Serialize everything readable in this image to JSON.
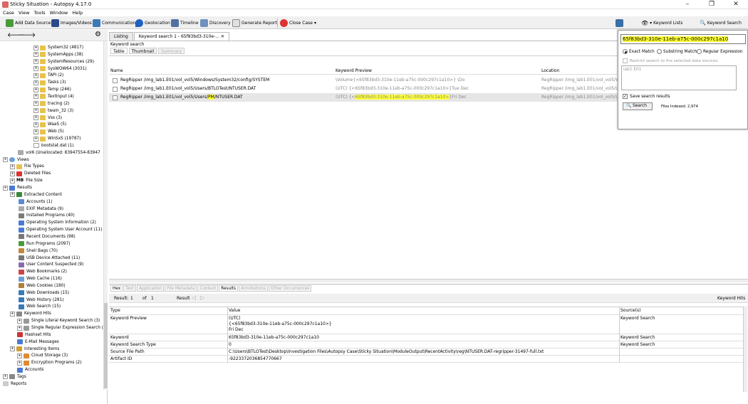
{
  "window": {
    "title": "Sticky Situation - Autopsy 4.17.0"
  },
  "menu": [
    "Case",
    "View",
    "Tools",
    "Window",
    "Help"
  ],
  "toolbar": {
    "add_data_source": "Add Data Source",
    "images_videos": "Images/Videos",
    "communications": "Communications",
    "geolocation": "Geolocation",
    "timeline": "Timeline",
    "discovery": "Discovery",
    "generate_report": "Generate Report",
    "close_case": "Close Case",
    "keyword_lists": "Keyword Lists",
    "keyword_search": "Keyword Search"
  },
  "tree": {
    "files": [
      "System32 (4817)",
      "SystemApps (38)",
      "SystemResources (29)",
      "SysWOW64 (3031)",
      "TAPI (2)",
      "Tasks (3)",
      "Temp (246)",
      "TextInput (4)",
      "tracing (2)",
      "twain_32 (3)",
      "Vss (3)",
      "WaaS (5)",
      "Web (5)",
      "WinSxS (19787)",
      "bootstat.dat (1)"
    ],
    "vol6": "vol6 (Unallocated: 83947554-83947",
    "views": "Views",
    "file_types": "File Types",
    "deleted_files": "Deleted Files",
    "mb_icon": "MB",
    "file_size": "File Size",
    "results": "Results",
    "extracted_content": "Extracted Content",
    "extracted": [
      "Accounts (1)",
      "EXIF Metadata (9)",
      "Installed Programs (40)",
      "Operating System Information (2)",
      "Operating System User Account (11)",
      "Recent Documents (98)",
      "Run Programs (2097)",
      "Shell Bags (70)",
      "USB Device Attached (11)",
      "User Content Suspected (9)",
      "Web Bookmarks (2)",
      "Web Cache (116)",
      "Web Cookies (180)",
      "Web Downloads (15)",
      "Web History (281)",
      "Web Search (15)"
    ],
    "keyword_hits": "Keyword Hits",
    "kw_children": [
      "Single Literal Keyword Search (3)",
      "Single Regular Expression Search (0)"
    ],
    "hashset_hits": "Hashset Hits",
    "email_messages": "E-Mail Messages",
    "interesting_items": "Interesting Items",
    "interesting_children": [
      "Cloud Storage (3)",
      "Encryption Programs (2)"
    ],
    "accounts": "Accounts",
    "tags": "Tags",
    "reports": "Reports"
  },
  "tabs": [
    "Listing",
    "Keyword search 1 - 65f83bd3-310e-..."
  ],
  "result_header": "Keyword search",
  "subtabs": [
    "Table",
    "Thumbnail",
    "Summary"
  ],
  "table": {
    "columns": [
      "Name",
      "Keyword Preview",
      "Location"
    ],
    "rows": [
      {
        "name": "RegRipper /img_lab1.E01/vol_vol5/Windows/System32/config/SYSTEM",
        "preview": "\\Volume{<65f83bd3-310e-11eb-a75c-000c297c1a10>} \\Do",
        "location": "RegRipper /img_lab1.E01/vol_vol5/Window"
      },
      {
        "name": "RegRipper /img_lab1.E01/vol_vol5/Users/BTLOTest/NTUSER.DAT",
        "preview": "(UTC)  {<65f83bd3-310e-11eb-a75c-000c297c1a10>}Tue Dec",
        "location": "RegRipper /img_lab1.E01/vol_vol5/Users"
      },
      {
        "name_pre": "RegRipper /img_lab1.E01/vol_vol5/Users/",
        "name_hl": "PM",
        "name_post": "/NTUSER.DAT",
        "preview_pre": "(UTC)  {<",
        "preview_hl": "65f83bd3-310e-11eb-a75c-000c297c1a10>",
        "preview_post": "}Fri Dec",
        "location": "RegRipper /img_lab1.E01/vol_vol5/Users"
      }
    ]
  },
  "kw_panel": {
    "query": "65f83bd3-310e-11eb-a75c-000c297c1a10",
    "exact": "Exact Match",
    "substring": "Substring Match",
    "regex": "Regular Expression",
    "restrict": "Restrict search to the selected data sources:",
    "datasource": "lab1.E01",
    "save": "Save search results",
    "search_btn": "Search",
    "files_indexed": "Files Indexed: 2,974"
  },
  "bottom": {
    "tabs": [
      "Hex",
      "Text",
      "Application",
      "File Metadata",
      "Context",
      "Results",
      "Annotations",
      "Other Occurrences"
    ],
    "result_label": "Result:",
    "result_num": "1",
    "of": "of",
    "total": "1",
    "result2": "Result",
    "right_label": "Keyword Hits",
    "columns": [
      "Type",
      "Value",
      "Source(s)"
    ],
    "rows": [
      {
        "type": "Keyword Preview",
        "value": [
          "(UTC)",
          "  {<65f83bd3-310e-11eb-a75c-000c297c1a10>}",
          "Fri Dec"
        ],
        "source": "Keyword Search"
      },
      {
        "type": "Keyword",
        "value": "65f83bd3-310e-11eb-a75c-000c297c1a10",
        "source": "Keyword Search"
      },
      {
        "type": "Keyword Search Type",
        "value": "0",
        "source": "Keyword Search"
      },
      {
        "type": "Source File Path",
        "value": "C:\\Users\\BTLOTest\\Desktop\\Investigation Files\\Autopsy Case\\Sticky Situation\\ModuleOutput\\RecentActivity\\reg\\NTUSER.DAT-regripper-31497-full.txt",
        "source": ""
      },
      {
        "type": "Artifact ID",
        "value": "-9223372036854770667",
        "source": ""
      }
    ]
  }
}
